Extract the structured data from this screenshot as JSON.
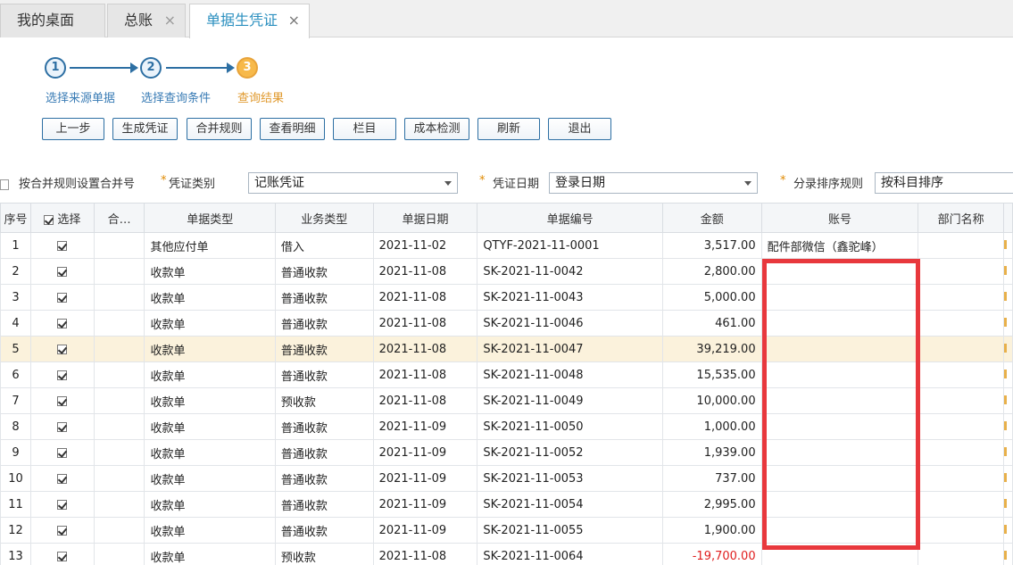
{
  "tabs": [
    {
      "label": "我的桌面",
      "closable": false
    },
    {
      "label": "总账",
      "closable": true
    },
    {
      "label": "单据生凭证",
      "closable": true,
      "active": true
    }
  ],
  "stepper": {
    "steps": [
      {
        "num": "1",
        "label": "选择来源单据"
      },
      {
        "num": "2",
        "label": "选择查询条件"
      },
      {
        "num": "3",
        "label": "查询结果",
        "current": true
      }
    ]
  },
  "toolbar": [
    "上一步",
    "生成凭证",
    "合并规则",
    "查看明细",
    "栏目",
    "成本检测",
    "刷新",
    "退出"
  ],
  "options": {
    "merge_checkbox_label": "按合并规则设置合并号",
    "voucher_type_label": "凭证类别",
    "voucher_type_value": "记账凭证",
    "voucher_date_label": "凭证日期",
    "voucher_date_value": "登录日期",
    "sort_rule_label": "分录排序规则",
    "sort_rule_value": "按科目排序",
    "required_mark": "*"
  },
  "grid": {
    "headers": [
      "序号",
      "选择",
      "合…",
      "单据类型",
      "业务类型",
      "单据日期",
      "单据编号",
      "金额",
      "账号",
      "部门名称",
      ""
    ],
    "rows": [
      {
        "seq": "1",
        "type": "其他应付单",
        "biz": "借入",
        "date": "2021-11-02",
        "no": "QTYF-2021-11-0001",
        "amount": "3,517.00",
        "account": "配件部微信（鑫驼峰）"
      },
      {
        "seq": "2",
        "type": "收款单",
        "biz": "普通收款",
        "date": "2021-11-08",
        "no": "SK-2021-11-0042",
        "amount": "2,800.00",
        "account": ""
      },
      {
        "seq": "3",
        "type": "收款单",
        "biz": "普通收款",
        "date": "2021-11-08",
        "no": "SK-2021-11-0043",
        "amount": "5,000.00",
        "account": ""
      },
      {
        "seq": "4",
        "type": "收款单",
        "biz": "普通收款",
        "date": "2021-11-08",
        "no": "SK-2021-11-0046",
        "amount": "461.00",
        "account": ""
      },
      {
        "seq": "5",
        "type": "收款单",
        "biz": "普通收款",
        "date": "2021-11-08",
        "no": "SK-2021-11-0047",
        "amount": "39,219.00",
        "account": "",
        "highlight": true
      },
      {
        "seq": "6",
        "type": "收款单",
        "biz": "普通收款",
        "date": "2021-11-08",
        "no": "SK-2021-11-0048",
        "amount": "15,535.00",
        "account": ""
      },
      {
        "seq": "7",
        "type": "收款单",
        "biz": "预收款",
        "date": "2021-11-08",
        "no": "SK-2021-11-0049",
        "amount": "10,000.00",
        "account": ""
      },
      {
        "seq": "8",
        "type": "收款单",
        "biz": "普通收款",
        "date": "2021-11-09",
        "no": "SK-2021-11-0050",
        "amount": "1,000.00",
        "account": ""
      },
      {
        "seq": "9",
        "type": "收款单",
        "biz": "普通收款",
        "date": "2021-11-09",
        "no": "SK-2021-11-0052",
        "amount": "1,939.00",
        "account": ""
      },
      {
        "seq": "10",
        "type": "收款单",
        "biz": "普通收款",
        "date": "2021-11-09",
        "no": "SK-2021-11-0053",
        "amount": "737.00",
        "account": ""
      },
      {
        "seq": "11",
        "type": "收款单",
        "biz": "普通收款",
        "date": "2021-11-09",
        "no": "SK-2021-11-0054",
        "amount": "2,995.00",
        "account": ""
      },
      {
        "seq": "12",
        "type": "收款单",
        "biz": "普通收款",
        "date": "2021-11-09",
        "no": "SK-2021-11-0055",
        "amount": "1,900.00",
        "account": ""
      },
      {
        "seq": "13",
        "type": "收款单",
        "biz": "预收款",
        "date": "2021-11-08",
        "no": "SK-2021-11-0064",
        "amount": "-19,700.00",
        "account": "",
        "negative": true
      }
    ]
  },
  "colors": {
    "accent": "#2a8fbf",
    "step_current": "#f7b94a",
    "highlight_row": "#fbf2dc",
    "annotation_box": "#e8383d",
    "negative": "#e02020"
  }
}
